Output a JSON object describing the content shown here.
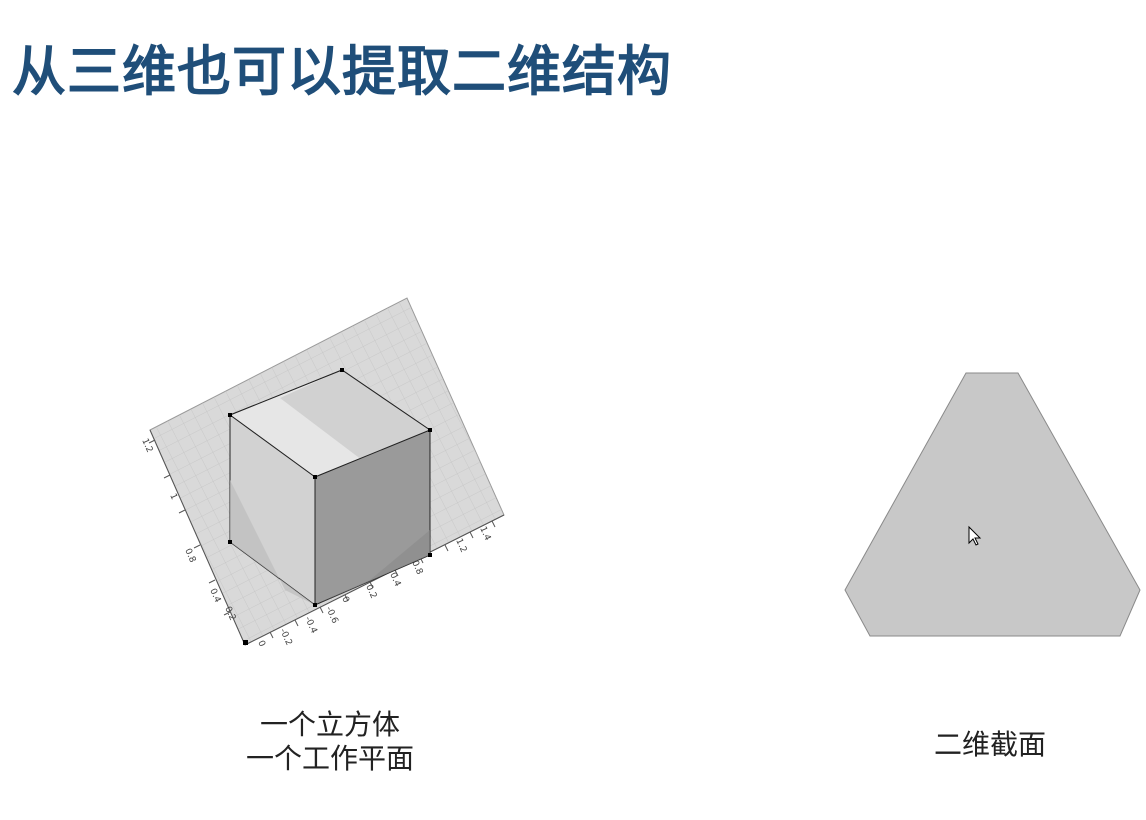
{
  "slide": {
    "title": "从三维也可以提取二维结构"
  },
  "left_figure": {
    "tick_labels": [
      "1.2",
      "1",
      "0.8",
      "0.4",
      "0.2",
      "0",
      "-0.2",
      "-0.4",
      "-0.6",
      "-0.8",
      "-1",
      "1.4",
      "1.2",
      "1",
      "0.8",
      "0.4",
      "0.2",
      "0",
      "-0.2"
    ],
    "caption_line1": "一个立方体",
    "caption_line2": "一个工作平面"
  },
  "right_figure": {
    "caption": "二维截面"
  },
  "colors": {
    "title": "#1f4e79",
    "plane_fill": "#d9d9d9",
    "plane_grid": "#c4c4c4",
    "cube_top": "#e6e6e6",
    "cube_left": "#d2d2d2",
    "cube_right": "#9a9a9a",
    "section_fill": "#c8c8c8"
  },
  "icons": {
    "cursor": "mouse-pointer-icon"
  }
}
